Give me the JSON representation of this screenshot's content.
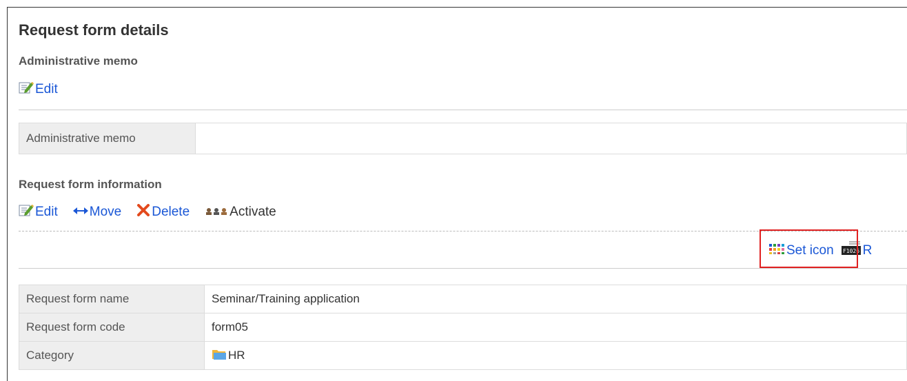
{
  "page": {
    "title": "Request form details"
  },
  "admin_memo_section": {
    "heading": "Administrative memo",
    "edit_label": "Edit",
    "table": {
      "label": "Administrative memo",
      "value": ""
    }
  },
  "request_form_section": {
    "heading": "Request form information",
    "actions": {
      "edit": "Edit",
      "move": "Move",
      "delete": "Delete",
      "activate": "Activate"
    },
    "toolbar": {
      "set_icon": "Set icon",
      "truncated_next": "R"
    },
    "rows": [
      {
        "label": "Request form name",
        "value": "Seminar/Training application"
      },
      {
        "label": "Request form code",
        "value": "form05"
      },
      {
        "label": "Category",
        "value": "HR"
      }
    ]
  },
  "icons": {
    "edit": "edit-pencil-icon",
    "move": "move-arrows-icon",
    "delete": "delete-x-icon",
    "activate": "activate-users-icon",
    "set_icon": "color-grid-icon",
    "code_icon": "f1026-code-icon",
    "category": "folder-icon"
  },
  "colors": {
    "link": "#1a57d6",
    "highlight": "#e02020",
    "label_bg": "#eeeeee"
  }
}
